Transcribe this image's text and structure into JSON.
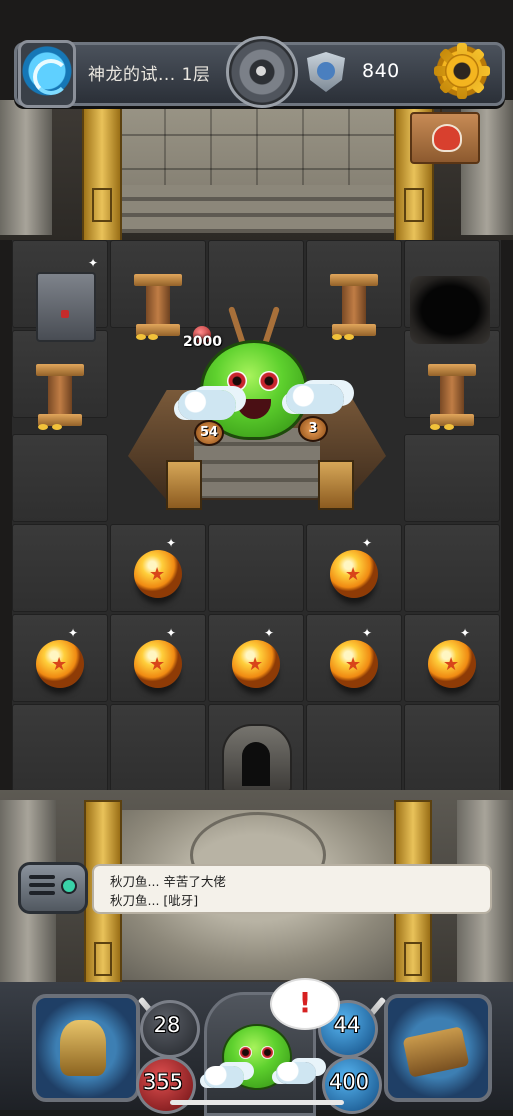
{
  "header": {
    "level_name": "神龙的试... 1层",
    "score": "840"
  },
  "enemy": {
    "hp": "2000",
    "attack": "54",
    "defense": "3"
  },
  "chat": {
    "lines": [
      "秋刀鱼...  辛苦了大佬",
      "秋刀鱼...  [呲牙]"
    ]
  },
  "player": {
    "attack": "28",
    "defense": "44",
    "hp": "355",
    "magic": "400"
  },
  "hud": {
    "alert_symbol": "!"
  },
  "colors": {
    "gold": "#f4b51f",
    "slime_green": "#5ed12e",
    "orb_orange": "#f08a12",
    "alert_red": "#d62020"
  }
}
